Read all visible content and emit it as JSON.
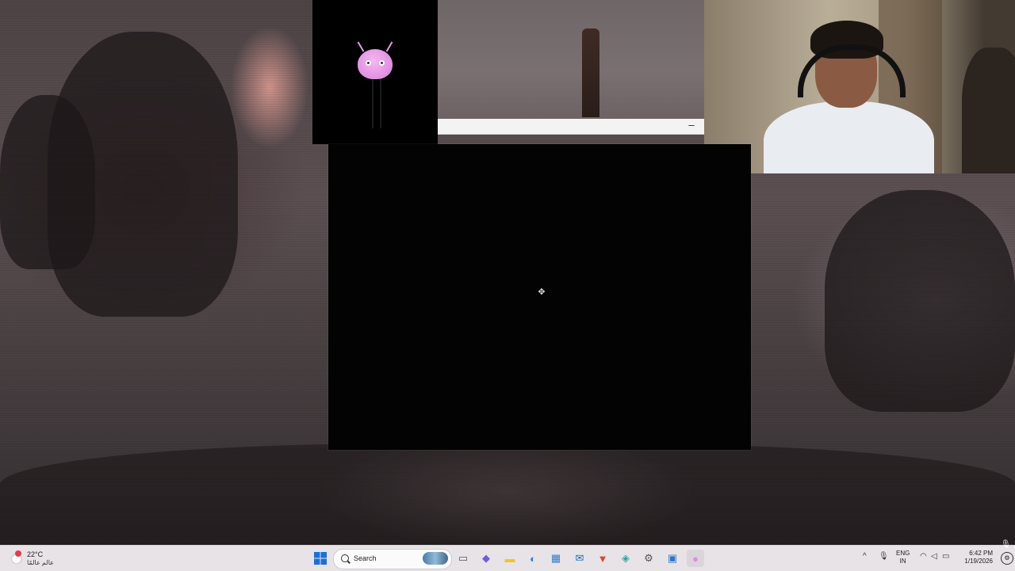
{
  "taskbar": {
    "weather": {
      "temperature": "22°C",
      "location": "عالم عالمًا",
      "icon": "weather-cloud-icon"
    },
    "start_icon": "windows-start-icon",
    "search": {
      "label": "Search"
    },
    "pinned": [
      {
        "name": "file-manager-icon",
        "glyph": "▭",
        "color": "#5a5a5a"
      },
      {
        "name": "copilot-icon",
        "glyph": "◆",
        "color": "#6c5ce7"
      },
      {
        "name": "file-explorer-icon",
        "glyph": "▬",
        "color": "#f2c230"
      },
      {
        "name": "edge-browser-icon",
        "glyph": "◐",
        "color": "#1e88c8"
      },
      {
        "name": "microsoft-store-icon",
        "glyph": "▦",
        "color": "#2d7dd2"
      },
      {
        "name": "outlook-icon",
        "glyph": "✉",
        "color": "#0f6cbd"
      },
      {
        "name": "brave-browser-icon",
        "glyph": "▼",
        "color": "#e2452a"
      },
      {
        "name": "microsoft-365-icon",
        "glyph": "◈",
        "color": "#2aa8a0"
      },
      {
        "name": "settings-icon",
        "glyph": "⚙",
        "color": "#555555"
      },
      {
        "name": "remote-app-icon",
        "glyph": "▣",
        "color": "#2f73c9"
      },
      {
        "name": "pink-mascot-app-icon",
        "glyph": "●",
        "color": "#e48ae8"
      }
    ],
    "tray": {
      "chevron": "^",
      "language": [
        "ENG",
        "IN"
      ],
      "time": "6:42 PM",
      "date": "1/19/2026"
    }
  },
  "mini_window": {
    "minimize_label": "–"
  },
  "colors": {
    "mascot": "#e48ae8",
    "taskbar": "#ede9ec"
  }
}
